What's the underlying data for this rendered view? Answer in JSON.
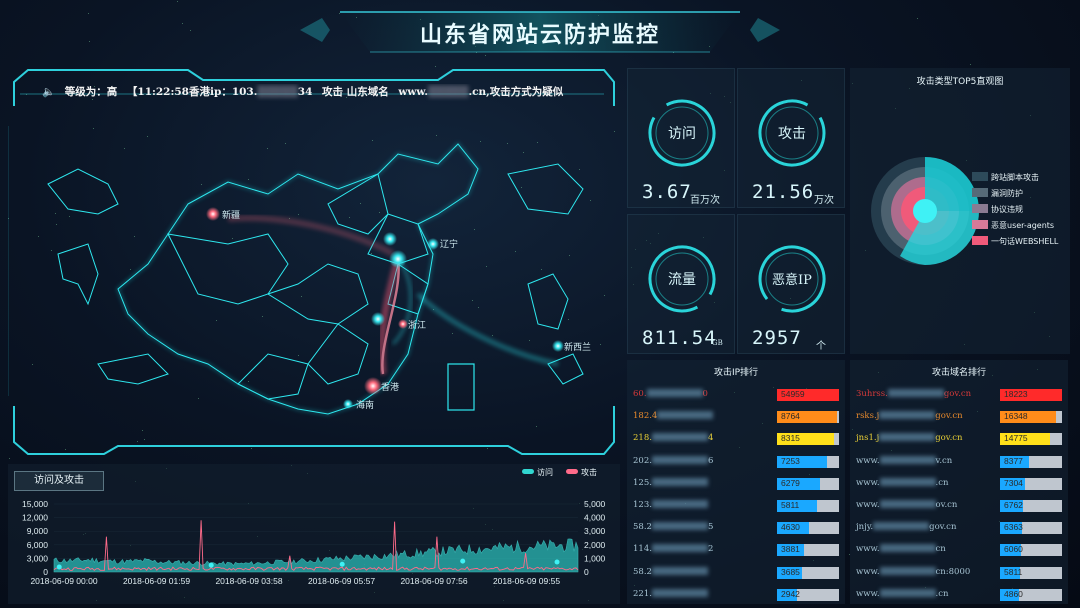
{
  "page": {
    "title": "山东省网站云防护监控"
  },
  "ticker": {
    "level_label": "等级为：",
    "level_value": "高",
    "time": "【11:22:58",
    "source_label": "香港ip：103.",
    "source_masked": "▒▒▒▒▒",
    "source_end": "34",
    "action": "攻击 山东域名",
    "domain_start": "www.",
    "domain_masked": "▒▒▒▒▒",
    "domain_end": ".cn,攻击方式为疑似"
  },
  "map": {
    "cities": [
      "新疆",
      "辽宁",
      "浙江",
      "香港",
      "海南",
      "新西兰"
    ],
    "accent_color": "#1fe0e8",
    "attack_color": "#ff6b7e"
  },
  "stats": [
    {
      "label": "访问",
      "value": "3.67",
      "unit": "百万次"
    },
    {
      "label": "攻击",
      "value": "21.56",
      "unit": "万次"
    },
    {
      "label": "流量",
      "value": "811.54",
      "unit": "GB"
    },
    {
      "label": "恶意IP",
      "value": "2957",
      "unit": "个"
    }
  ],
  "pie": {
    "title": "攻击类型TOP5直观图",
    "legend": [
      {
        "name": "跨站脚本攻击",
        "color": "#2d4a5a"
      },
      {
        "name": "漏洞防护",
        "color": "#566a78"
      },
      {
        "name": "协议违规",
        "color": "#8a7b92"
      },
      {
        "name": "恶意user-agents",
        "color": "#d77a98"
      },
      {
        "name": "一句话WEBSHELL",
        "color": "#f05a7a"
      }
    ]
  },
  "ip_rank": {
    "title": "攻击IP排行",
    "rows": [
      {
        "prefix": "60.",
        "suffix": "0",
        "value": 54959,
        "color": "#ff2a2a",
        "text_color": "#d63a3a"
      },
      {
        "prefix": "182.4",
        "suffix": "",
        "value": 8764,
        "color": "#ff8c1a",
        "text_color": "#e88a2c"
      },
      {
        "prefix": "218.",
        "suffix": "4",
        "value": 8315,
        "color": "#ffe01a",
        "text_color": "#e8cf36"
      },
      {
        "prefix": "202.",
        "suffix": "6",
        "value": 7253,
        "color": "#1aa8ff",
        "text_color": "#a6c3d2"
      },
      {
        "prefix": "125.",
        "suffix": "",
        "value": 6279,
        "color": "#1aa8ff",
        "text_color": "#a6c3d2"
      },
      {
        "prefix": "123.",
        "suffix": "",
        "value": 5811,
        "color": "#1aa8ff",
        "text_color": "#a6c3d2"
      },
      {
        "prefix": "58.2",
        "suffix": "5",
        "value": 4630,
        "color": "#1aa8ff",
        "text_color": "#a6c3d2"
      },
      {
        "prefix": "114.",
        "suffix": "2",
        "value": 3881,
        "color": "#1aa8ff",
        "text_color": "#a6c3d2"
      },
      {
        "prefix": "58.2",
        "suffix": "",
        "value": 3685,
        "color": "#1aa8ff",
        "text_color": "#a6c3d2"
      },
      {
        "prefix": "221.",
        "suffix": "",
        "value": 2942,
        "color": "#1aa8ff",
        "text_color": "#a6c3d2"
      }
    ]
  },
  "domain_rank": {
    "title": "攻击域名排行",
    "rows": [
      {
        "prefix": "3uhrss.",
        "suffix": "gov.cn",
        "value": 18223,
        "color": "#ff2a2a",
        "text_color": "#d63a3a"
      },
      {
        "prefix": "rsks.j",
        "suffix": "gov.cn",
        "value": 16348,
        "color": "#ff8c1a",
        "text_color": "#e88a2c"
      },
      {
        "prefix": "jns1.j",
        "suffix": "gov.cn",
        "value": 14775,
        "color": "#ffe01a",
        "text_color": "#e8cf36"
      },
      {
        "prefix": "www.",
        "suffix": "v.cn",
        "value": 8377,
        "color": "#1aa8ff",
        "text_color": "#a6c3d2"
      },
      {
        "prefix": "www.",
        "suffix": ".cn",
        "value": 7304,
        "color": "#1aa8ff",
        "text_color": "#a6c3d2"
      },
      {
        "prefix": "www.",
        "suffix": "ov.cn",
        "value": 6762,
        "color": "#1aa8ff",
        "text_color": "#a6c3d2"
      },
      {
        "prefix": "jnjy.",
        "suffix": "gov.cn",
        "value": 6363,
        "color": "#1aa8ff",
        "text_color": "#a6c3d2"
      },
      {
        "prefix": "www.",
        "suffix": "cn",
        "value": 6060,
        "color": "#1aa8ff",
        "text_color": "#a6c3d2"
      },
      {
        "prefix": "www.",
        "suffix": "cn:8000",
        "value": 5811,
        "color": "#1aa8ff",
        "text_color": "#a6c3d2"
      },
      {
        "prefix": "www.",
        "suffix": ".cn",
        "value": 4860,
        "color": "#1aa8ff",
        "text_color": "#a6c3d2"
      }
    ]
  },
  "chart_data": {
    "type": "area",
    "title": "访问及攻击",
    "series": [
      {
        "name": "访问",
        "color": "#31d6d0",
        "axis": "left"
      },
      {
        "name": "攻击",
        "color": "#ff6b8a",
        "axis": "right"
      }
    ],
    "x_ticks": [
      "2018-06-09 00:00",
      "2018-06-09 01:59",
      "2018-06-09 03:58",
      "2018-06-09 05:57",
      "2018-06-09 07:56",
      "2018-06-09 09:55"
    ],
    "y_left_ticks": [
      "15,000",
      "12,000",
      "9,000",
      "6,000",
      "3,000",
      "0"
    ],
    "y_right_ticks": [
      "5,000",
      "4,000",
      "3,000",
      "2,000",
      "1,000",
      "0"
    ],
    "ylim_left": [
      0,
      15000
    ],
    "ylim_right": [
      0,
      5000
    ],
    "visits_profile": [
      2600,
      2500,
      2700,
      2400,
      2300,
      2500,
      2200,
      2100,
      2000,
      1900,
      1800,
      1900,
      2100,
      2300,
      2500,
      2800,
      3000,
      3300,
      3500,
      3800,
      4100,
      4400,
      4700,
      5000,
      5200,
      5400,
      5600,
      5700,
      5800,
      5900
    ],
    "attack_spikes": [
      [
        0.1,
        2600
      ],
      [
        0.28,
        3800
      ],
      [
        0.45,
        1200
      ],
      [
        0.65,
        3700
      ],
      [
        0.73,
        2600
      ],
      [
        0.9,
        1400
      ]
    ]
  }
}
